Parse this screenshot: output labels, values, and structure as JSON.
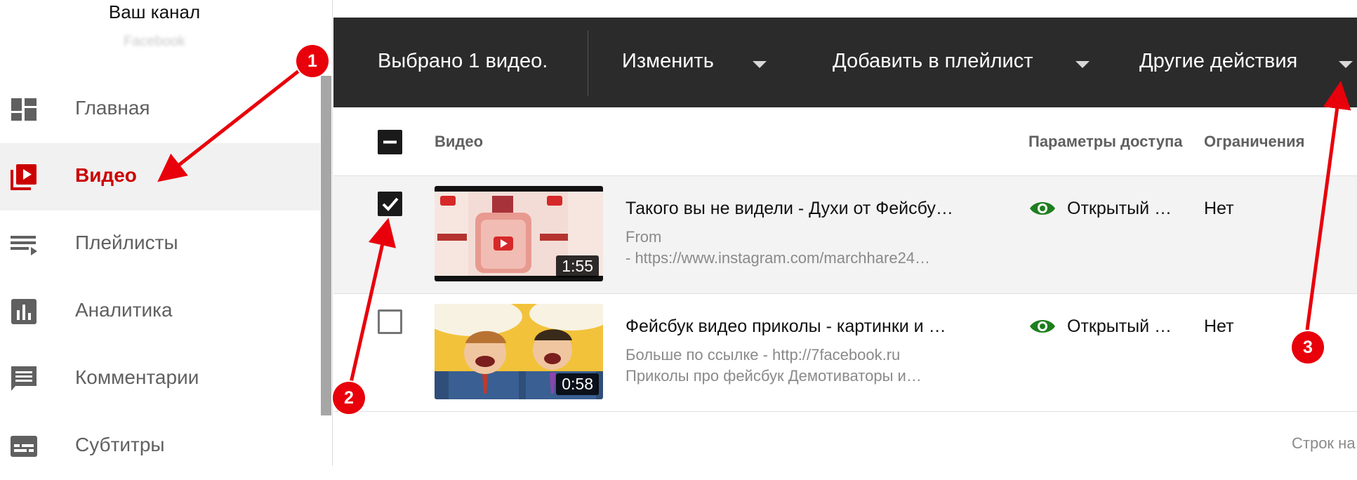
{
  "sidebar": {
    "channel_title": "Ваш канал",
    "channel_subtitle": "Facebook",
    "items": [
      {
        "label": "Главная",
        "icon": "dashboard-icon",
        "active": false
      },
      {
        "label": "Видео",
        "icon": "video-library-icon",
        "active": true
      },
      {
        "label": "Плейлисты",
        "icon": "playlist-icon",
        "active": false
      },
      {
        "label": "Аналитика",
        "icon": "analytics-icon",
        "active": false
      },
      {
        "label": "Комментарии",
        "icon": "comments-icon",
        "active": false
      },
      {
        "label": "Субтитры",
        "icon": "subtitles-icon",
        "active": false
      }
    ]
  },
  "action_bar": {
    "selected_text": "Выбрано 1 видео.",
    "edit_label": "Изменить",
    "add_playlist_label": "Добавить в плейлист",
    "more_actions_label": "Другие действия"
  },
  "table": {
    "headers": {
      "video": "Видео",
      "visibility": "Параметры доступа",
      "restrictions": "Ограничения"
    },
    "rows": [
      {
        "checked": true,
        "title": "Такого вы не видели - Духи от Фейсбу…",
        "desc_line1": "From",
        "desc_line2": "- https://www.instagram.com/marchhare24…",
        "duration": "1:55",
        "visibility": "Открытый …",
        "restrictions": "Нет"
      },
      {
        "checked": false,
        "title": "Фейсбук видео приколы - картинки и …",
        "desc_line1": "Больше по ссылке - http://7facebook.ru",
        "desc_line2": "Приколы про фейсбук Демотиваторы и…",
        "duration": "0:58",
        "visibility": "Открытый …",
        "restrictions": "Нет"
      }
    ],
    "rows_per_page_label": "Строк на"
  },
  "annotations": {
    "badge1": "1",
    "badge2": "2",
    "badge3": "3"
  },
  "colors": {
    "accent": "#cc0000",
    "action_bar": "#2b2b2b",
    "annotation": "#e8000b",
    "public_eye": "#1e7e1e"
  }
}
